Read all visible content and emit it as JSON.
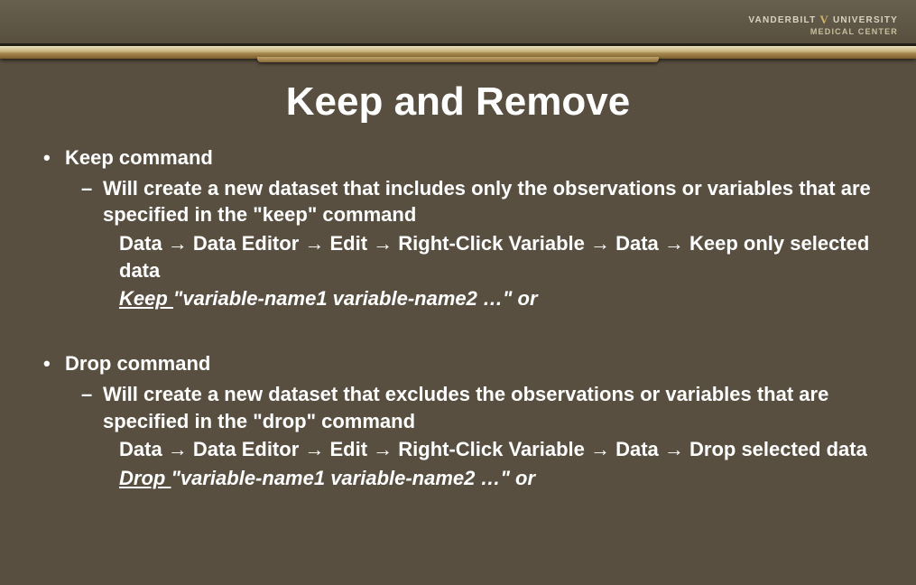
{
  "brand": {
    "line1_left": "VANDERBILT",
    "line1_right": "UNIVERSITY",
    "line2": "MEDICAL CENTER",
    "v": "V"
  },
  "title": "Keep and Remove",
  "arrow": "→",
  "keep": {
    "heading": "Keep command",
    "desc": "Will create a new dataset that includes only the observations or variables that are specified in the \"keep\" command",
    "path_parts": [
      "Data",
      "Data Editor",
      "Edit",
      "Right-Click Variable",
      "Data",
      "Keep only selected data"
    ],
    "syntax_cmd": "Keep ",
    "syntax_args": "\"variable-name1 variable-name2 …\" or"
  },
  "drop": {
    "heading": "Drop command",
    "desc": "Will create a new dataset that excludes the observations or variables that are specified in the \"drop\" command",
    "path_parts": [
      "Data",
      "Data Editor",
      "Edit",
      "Right-Click Variable",
      "Data",
      "Drop selected data"
    ],
    "syntax_cmd": "Drop ",
    "syntax_args": "\"variable-name1 variable-name2 …\" or"
  }
}
